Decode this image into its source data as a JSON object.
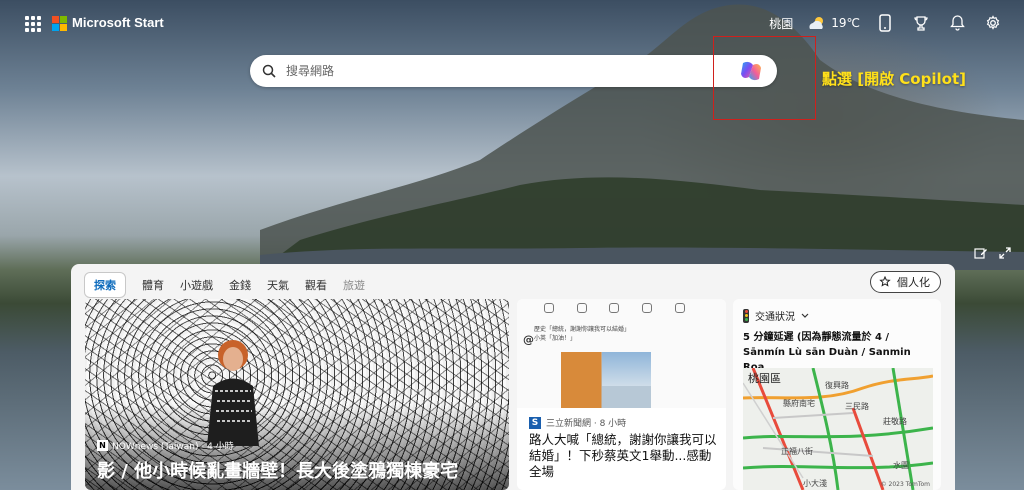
{
  "header": {
    "brand": "Microsoft Start",
    "location": "桃園",
    "temperature": "19℃"
  },
  "search": {
    "placeholder": "搜尋網路"
  },
  "annotation": {
    "text": "點選 [開啟 Copilot]"
  },
  "panel": {
    "tabs": [
      {
        "label": "探索"
      },
      {
        "label": "體育"
      },
      {
        "label": "小遊戲"
      },
      {
        "label": "金錢"
      },
      {
        "label": "天氣"
      },
      {
        "label": "觀看"
      },
      {
        "label": "旅遊"
      }
    ],
    "personalize_label": "個人化"
  },
  "main_card": {
    "source": "NOWnews (Taiwan) · 4 小時",
    "source_badge": "N",
    "title": "影 / 他小時候亂畫牆壁！長大後塗鴉獨棟豪宅"
  },
  "news_card": {
    "thumb_text_line1": "歷史「總統，謝謝你讓我可以結婚」",
    "thumb_text_line2": "小英「加油！」",
    "source_logo": "S",
    "source": "三立新聞網 · 8 小時",
    "title": "路人大喊「總統，謝謝你讓我可以結婚」！下秒蔡英文1舉動...感動全場"
  },
  "traffic_card": {
    "header": "交通狀況",
    "title": "5 分鐘延遲 (因為靜態流量於 4 / Sānmín Lù sān Duàn / Sanmin Roa...",
    "map_labels": {
      "city": "桃園區",
      "road1": "復興路",
      "road2": "縣府南宅",
      "road3": "三民路",
      "road4": "莊敬路",
      "road5": "正福八街",
      "road6": "小大淺",
      "road7": "水園"
    },
    "copyright": "© 2023 TomTom"
  },
  "colors": {
    "accent": "#0f6cbd",
    "annotation": "#ffe01a",
    "highlight_box": "#d0201c"
  }
}
